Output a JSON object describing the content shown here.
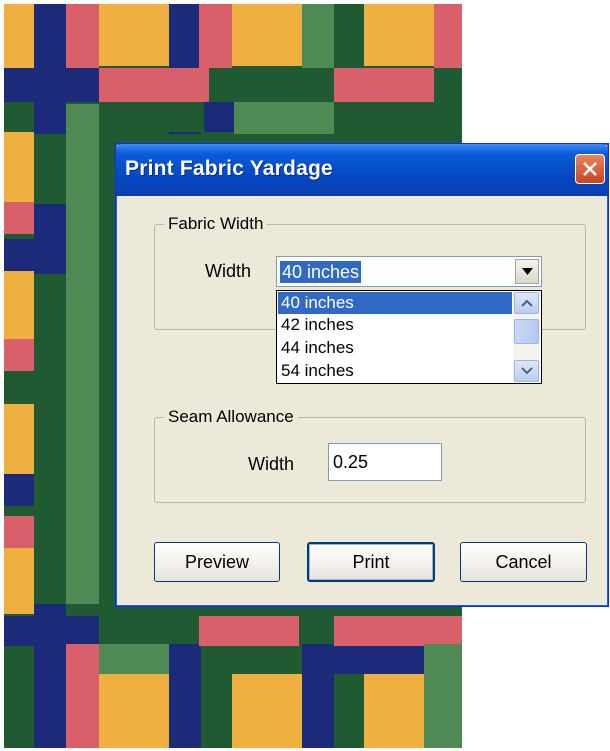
{
  "dialog": {
    "title": "Print Fabric Yardage",
    "close_icon": "close-icon",
    "fabric_width": {
      "group_label": "Fabric Width",
      "width_label": "Width",
      "selected_value": "40 inches",
      "options": [
        "40 inches",
        "42 inches",
        "44 inches",
        "54 inches"
      ]
    },
    "seam_allowance": {
      "group_label": "Seam Allowance",
      "width_label": "Width",
      "value": "0.25"
    },
    "buttons": {
      "preview": "Preview",
      "print": "Print",
      "cancel": "Cancel"
    }
  },
  "colors": {
    "quilt_gold": "#f0b040",
    "quilt_pink": "#d9606a",
    "quilt_navy": "#1c2a7a",
    "quilt_green": "#4f8a55",
    "quilt_darkgreen": "#1f5a33",
    "title_blue": "#0449c4",
    "selection_blue": "#316ac5"
  }
}
